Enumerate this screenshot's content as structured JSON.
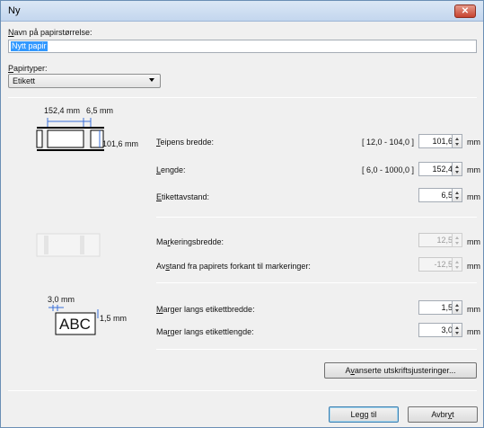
{
  "window": {
    "title": "Ny",
    "close_icon": "close-icon"
  },
  "paper_name": {
    "label_pre": "N",
    "label_rest": "avn på papirstørrelse:",
    "value": "Nytt papir"
  },
  "paper_type": {
    "label_pre": "P",
    "label_rest": "apirtyper:",
    "value": "Etikett"
  },
  "diagram_top": {
    "width_text": "152,4 mm",
    "gap_text": "6,5 mm",
    "height_text": "101,6 mm"
  },
  "diagram_bottom": {
    "top_margin_text": "3,0 mm",
    "side_margin_text": "1,5 mm",
    "sample_text": "ABC"
  },
  "fields": [
    {
      "label_pre": "T",
      "label_rest": "eipens bredde:",
      "range": "[ 12,0 - 104,0 ]",
      "value": "101,6",
      "unit": "mm",
      "enabled": true
    },
    {
      "label_pre": "L",
      "label_rest": "engde:",
      "range": "[ 6,0 - 1000,0 ]",
      "value": "152,4",
      "unit": "mm",
      "enabled": true
    },
    {
      "label_pre": "E",
      "label_rest": "tikettavstand:",
      "range": "",
      "value": "6,5",
      "unit": "mm",
      "enabled": true
    },
    {
      "label_pre": "Ma",
      "label_u": "r",
      "label_rest": "keringsbredde:",
      "range": "",
      "value": "12,5",
      "unit": "mm",
      "enabled": false
    },
    {
      "label_pre": "Av",
      "label_u": "s",
      "label_rest": "tand fra papirets forkant til markeringer:",
      "range": "",
      "value": "-12,5",
      "unit": "mm",
      "enabled": false
    },
    {
      "label_pre": "M",
      "label_rest": "arger langs etikettbredde:",
      "range": "",
      "value": "1,5",
      "unit": "mm",
      "enabled": true
    },
    {
      "label_pre": "Ma",
      "label_u": "r",
      "label_rest": "ger langs etikettlengde:",
      "range": "",
      "value": "3,0",
      "unit": "mm",
      "enabled": true
    }
  ],
  "buttons": {
    "advanced_pre": "A",
    "advanced_u": "v",
    "advanced_rest": "anserte utskriftsjusteringer...",
    "add": "Legg til",
    "cancel_pre": "Avbr",
    "cancel_u": "y",
    "cancel_rest": "t"
  }
}
